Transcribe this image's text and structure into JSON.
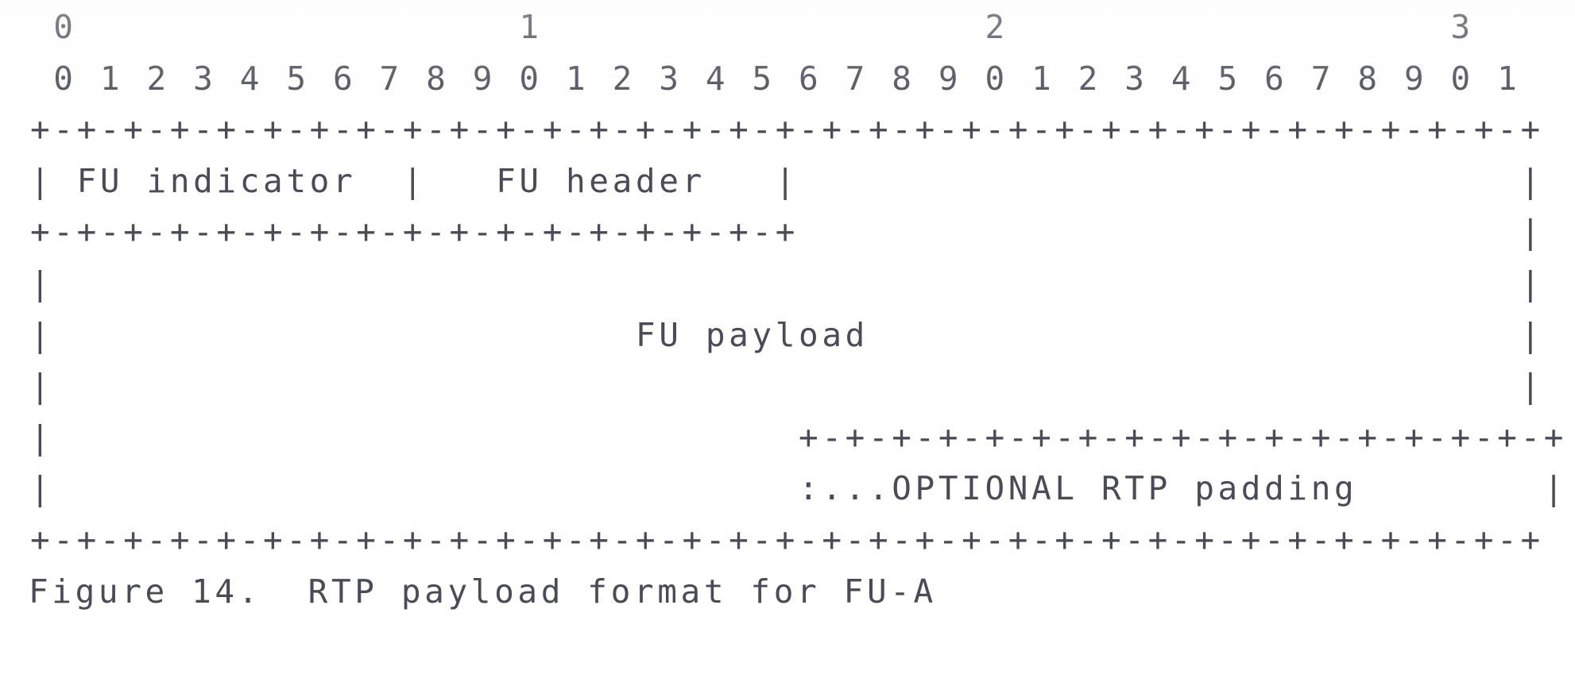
{
  "figure": {
    "id": "rfc6184-figure-14",
    "caption": "Figure 14.  RTP payload format for FU-A",
    "ink_color": "#4b4b57",
    "background_color": "#ffffff",
    "bit_width": 32,
    "ruler": {
      "decade_row": " 0                   1                   2                   3",
      "digit_row": " 0 1 2 3 4 5 6 7 8 9 0 1 2 3 4 5 6 7 8 9 0 1 2 3 4 5 6 7 8 9 0 1",
      "decade_labels": [
        "0",
        "1",
        "2",
        "3"
      ],
      "digit_labels": [
        "0",
        "1",
        "2",
        "3",
        "4",
        "5",
        "6",
        "7",
        "8",
        "9",
        "0",
        "1",
        "2",
        "3",
        "4",
        "5",
        "6",
        "7",
        "8",
        "9",
        "0",
        "1",
        "2",
        "3",
        "4",
        "5",
        "6",
        "7",
        "8",
        "9",
        "0",
        "1"
      ]
    },
    "separator_full": "+-+-+-+-+-+-+-+-+-+-+-+-+-+-+-+-+-+-+-+-+-+-+-+-+-+-+-+-+-+-+-+-+",
    "separator_half": "+-+-+-+-+-+-+-+-+-+-+-+-+-+-+-+-+",
    "separator_tail": "                +-+-+-+-+-+-+-+-+-+-+-+-+-+-+-+-+",
    "fields": [
      {
        "name": "FU indicator",
        "label": "FU indicator",
        "bits": 8
      },
      {
        "name": "FU header",
        "label": "FU header",
        "bits": 8
      },
      {
        "name": "FU payload",
        "label": "FU payload",
        "bits": "variable"
      },
      {
        "name": "OPTIONAL RTP padding",
        "label": ":...OPTIONAL RTP padding",
        "bits": "variable"
      }
    ],
    "lines": [
      " 0                   1                   2                   3",
      " 0 1 2 3 4 5 6 7 8 9 0 1 2 3 4 5 6 7 8 9 0 1 2 3 4 5 6 7 8 9 0 1",
      "+-+-+-+-+-+-+-+-+-+-+-+-+-+-+-+-+-+-+-+-+-+-+-+-+-+-+-+-+-+-+-+-+",
      "| FU indicator  |   FU header   |                               |",
      "+-+-+-+-+-+-+-+-+-+-+-+-+-+-+-+-+                               |",
      "|                                                               |",
      "|                         FU payload                            |",
      "|                                                               |",
      "|                                +-+-+-+-+-+-+-+-+-+-+-+-+-+-+-+-+",
      "|                                :...OPTIONAL RTP padding        |",
      "+-+-+-+-+-+-+-+-+-+-+-+-+-+-+-+-+-+-+-+-+-+-+-+-+-+-+-+-+-+-+-+-+"
    ],
    "line_count": 11
  }
}
